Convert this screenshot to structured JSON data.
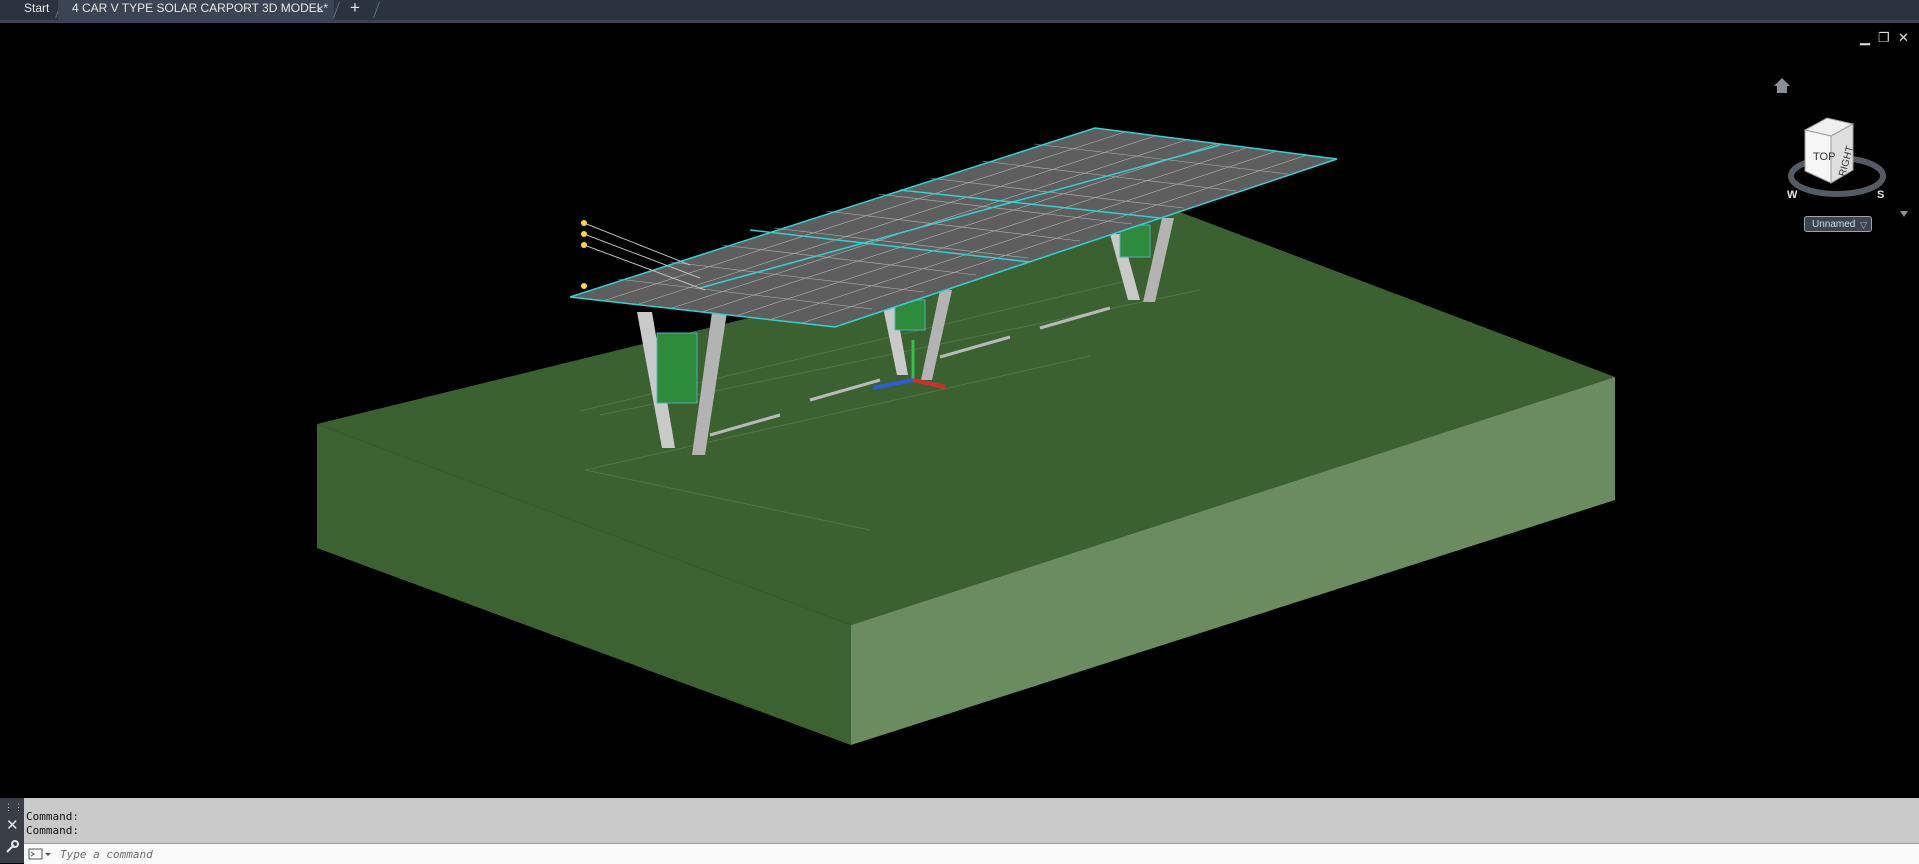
{
  "tabs": {
    "start_label": "Start",
    "active_label": "4 CAR V TYPE SOLAR CARPORT 3D MODEL*",
    "close_glyph": "×",
    "new_tab_glyph": "+"
  },
  "window_controls": {
    "minimize_glyph": "▁",
    "restore_glyph": "❐",
    "close_glyph": "✕"
  },
  "viewcube": {
    "face_top": "TOP",
    "face_right": "RIGHT",
    "compass_w": "W",
    "compass_s": "S",
    "home_icon": "home-icon"
  },
  "named_view": {
    "label": "Unnamed",
    "arrow": "▽"
  },
  "command_line": {
    "history": [
      "Command:",
      "Command:"
    ],
    "placeholder": "Type a command"
  },
  "colors": {
    "background": "#000000",
    "ground_top": "#3b6131",
    "ground_left": "#3d6232",
    "ground_right": "#6a8c5f",
    "solar_panel": "#5e5e5e",
    "panel_edges": "#2fd3d3",
    "tab_bar": "#2b3340",
    "command_bg": "#c9c9c9"
  }
}
